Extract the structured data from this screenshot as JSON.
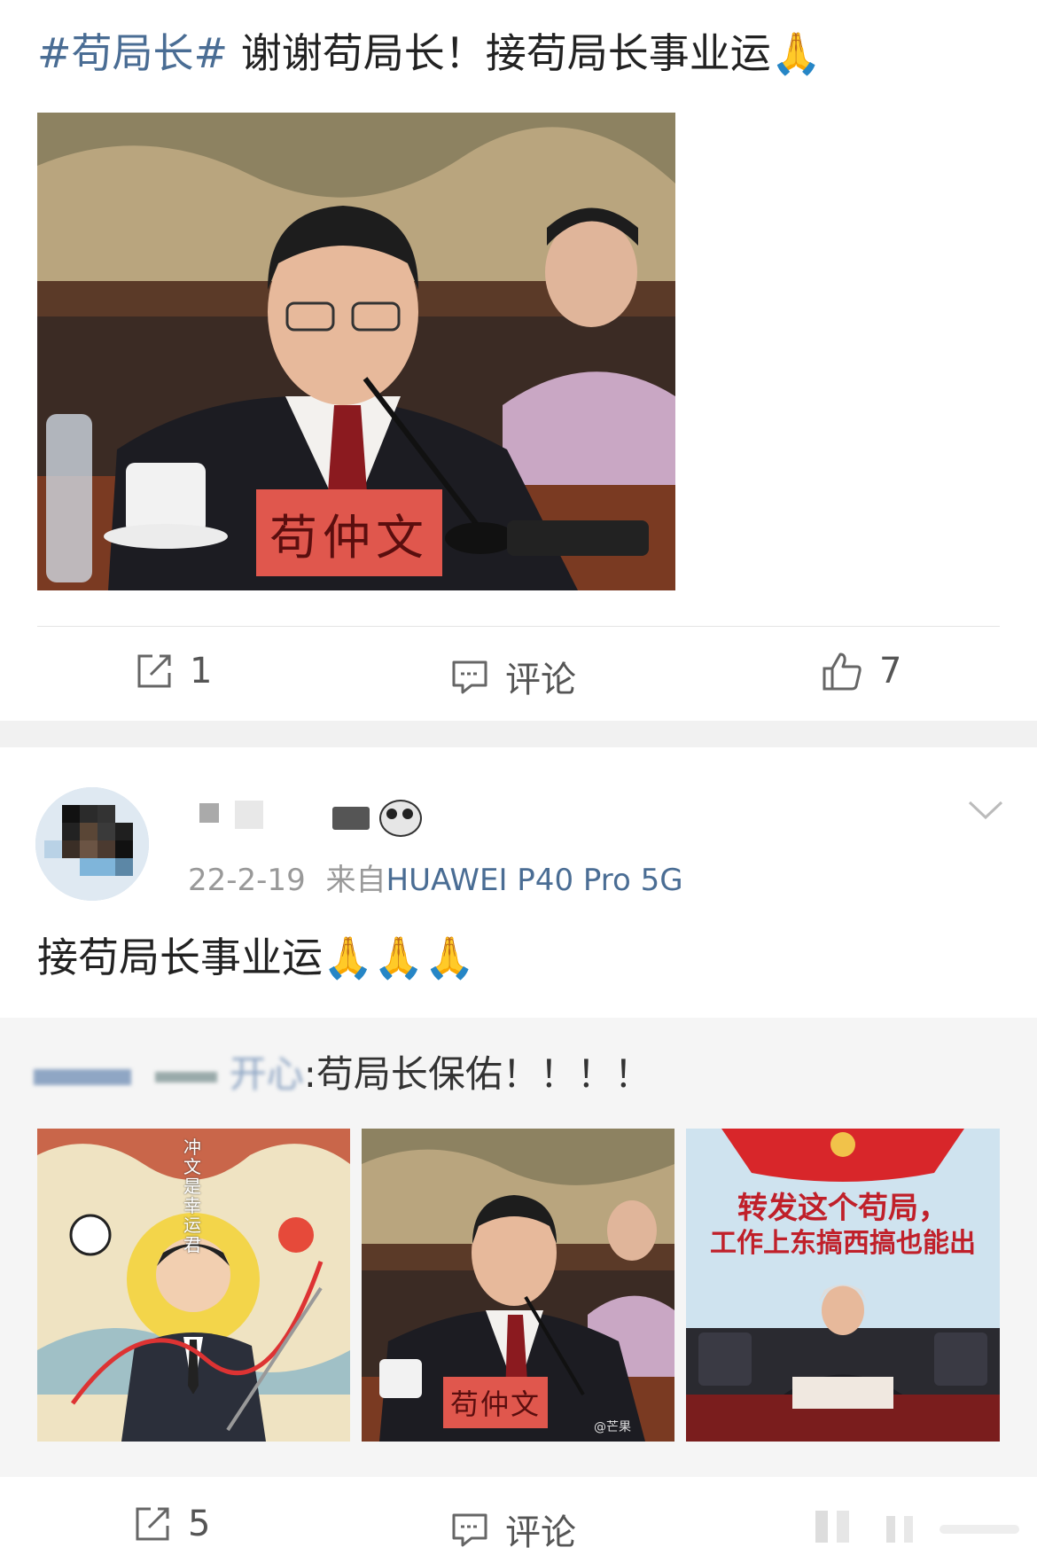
{
  "post1": {
    "hashtag": "#苟局长#",
    "text": " 谢谢苟局长！接苟局长事业运",
    "emoji": "🙏",
    "nameplate": "苟仲文",
    "actions": {
      "share_count": "1",
      "comment_label": "评论",
      "like_count": "7"
    }
  },
  "post2": {
    "username_suffix": "",
    "date": "22-2-19",
    "source_prefix": "来自",
    "device": "HUAWEI P40 Pro 5G",
    "text": "接苟局长事业运",
    "emojis": "🙏🙏🙏",
    "repost": {
      "author": "开心",
      "text": ":苟局长保佑！！！！",
      "images": [
        {
          "kind": "illustration",
          "vertical_text": "冲文是幸运君"
        },
        {
          "kind": "photo",
          "nameplate": "苟仲文",
          "watermark": "@芒果"
        },
        {
          "kind": "screenshot",
          "banner_line1": "转发这个苟局，",
          "banner_line2": "工作上东搞西搞也能出"
        }
      ]
    },
    "actions": {
      "share_count": "5",
      "comment_label": "评论"
    }
  },
  "colors": {
    "link": "#4a6d94",
    "text": "#222222",
    "meta": "#999999",
    "band": "#f1f1f1"
  }
}
